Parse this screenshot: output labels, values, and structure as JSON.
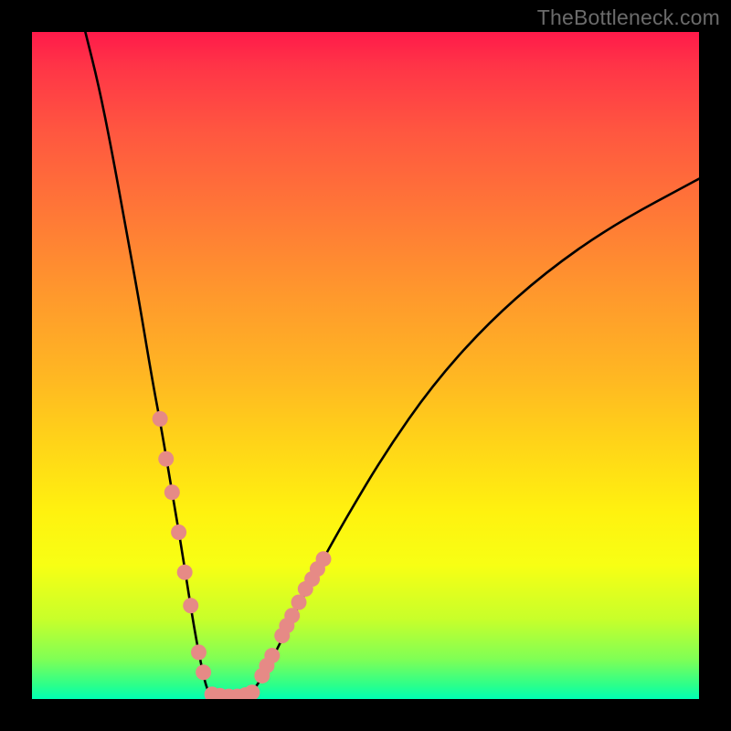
{
  "watermark": "TheBottleneck.com",
  "colors": {
    "curve": "#000000",
    "dot_fill": "#e68a86",
    "dot_stroke": "#d06a66",
    "green_band": "#00ffb4"
  },
  "chart_data": {
    "type": "line",
    "title": "",
    "xlabel": "",
    "ylabel": "",
    "xlim": [
      0,
      100
    ],
    "ylim": [
      0,
      100
    ],
    "series": [
      {
        "name": "left-curve",
        "x": [
          8,
          10,
          12,
          14,
          16,
          18,
          19.5,
          21,
          22.2,
          23.3,
          24.1,
          24.8,
          25.4,
          26,
          26.5
        ],
        "y": [
          100,
          92,
          82,
          71,
          60,
          48,
          40,
          31,
          24,
          17,
          12,
          8,
          5,
          2.3,
          1
        ]
      },
      {
        "name": "valley-floor",
        "x": [
          26.5,
          27.2,
          28,
          29,
          30,
          31,
          32,
          33
        ],
        "y": [
          1,
          0.6,
          0.4,
          0.3,
          0.3,
          0.4,
          0.6,
          1
        ]
      },
      {
        "name": "right-curve",
        "x": [
          33,
          35,
          38,
          42,
          47,
          53,
          60,
          68,
          77,
          87,
          100
        ],
        "y": [
          1,
          4,
          10,
          18,
          27,
          37,
          47,
          56,
          64,
          71,
          78
        ]
      }
    ],
    "dots_left": [
      {
        "x": 19.2,
        "y": 42
      },
      {
        "x": 20.1,
        "y": 36
      },
      {
        "x": 21.0,
        "y": 31
      },
      {
        "x": 22.0,
        "y": 25
      },
      {
        "x": 22.9,
        "y": 19
      },
      {
        "x": 23.8,
        "y": 14
      },
      {
        "x": 25.0,
        "y": 7
      },
      {
        "x": 25.7,
        "y": 4
      }
    ],
    "dots_right": [
      {
        "x": 34.5,
        "y": 3.5
      },
      {
        "x": 35.2,
        "y": 5
      },
      {
        "x": 36.0,
        "y": 6.5
      },
      {
        "x": 37.5,
        "y": 9.5
      },
      {
        "x": 38.2,
        "y": 11
      },
      {
        "x": 39.0,
        "y": 12.5
      },
      {
        "x": 40.0,
        "y": 14.5
      },
      {
        "x": 41.0,
        "y": 16.5
      },
      {
        "x": 42.0,
        "y": 18
      },
      {
        "x": 42.8,
        "y": 19.5
      },
      {
        "x": 43.7,
        "y": 21
      }
    ],
    "dots_bottom": [
      {
        "x": 27.0,
        "y": 0.7
      },
      {
        "x": 28.2,
        "y": 0.5
      },
      {
        "x": 29.5,
        "y": 0.4
      },
      {
        "x": 30.8,
        "y": 0.4
      },
      {
        "x": 32.0,
        "y": 0.6
      },
      {
        "x": 33.0,
        "y": 1.0
      }
    ]
  }
}
